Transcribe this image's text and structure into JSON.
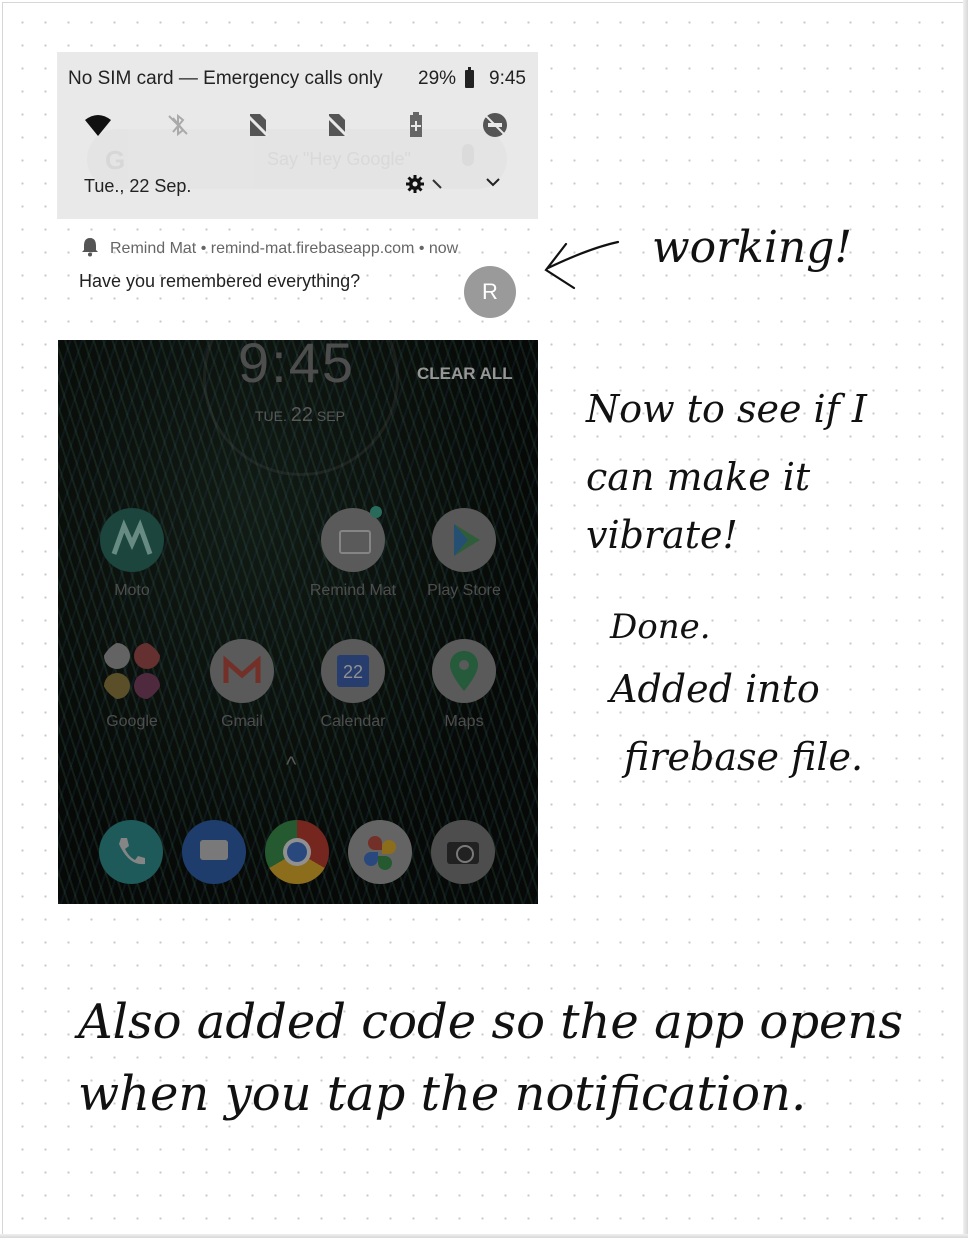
{
  "status_bar": {
    "carrier": "No SIM card — Emergency calls only",
    "battery_pct": "29%",
    "time": "9:45"
  },
  "quick_settings": {
    "tiles": [
      "wifi-icon",
      "bluetooth-off-icon",
      "mobile-data-off-icon",
      "sim-off-icon",
      "battery-saver-icon",
      "do-not-disturb-icon"
    ],
    "date": "Tue., 22 Sep.",
    "search_placeholder": "Say \"Hey Google\"",
    "google_glyph": "G"
  },
  "notification": {
    "header": "Remind Mat • remind-mat.firebaseapp.com • now",
    "message": "Have you remembered everything?",
    "avatar_letter": "R"
  },
  "home_screen": {
    "clock": "9:45",
    "date_day": "TUE",
    "date_num": "22",
    "date_month": "SEP",
    "clear_all": "CLEAR ALL",
    "apps_row1": [
      "Moto",
      "Remind Mat",
      "Play Store"
    ],
    "apps_row2": [
      "Google",
      "Gmail",
      "Calendar",
      "Maps"
    ],
    "calendar_day": "22",
    "dock": [
      "phone-icon",
      "messages-icon",
      "chrome-icon",
      "photos-icon",
      "camera-icon"
    ]
  },
  "handwriting": {
    "working": "working!",
    "line1": "Now to see if I",
    "line2": "can make it",
    "line3": "vibrate!",
    "done": "Done.",
    "added1": "Added into",
    "added2": "firebase file.",
    "bottom1": "Also added code so the app opens",
    "bottom2": "when you tap the notification."
  }
}
